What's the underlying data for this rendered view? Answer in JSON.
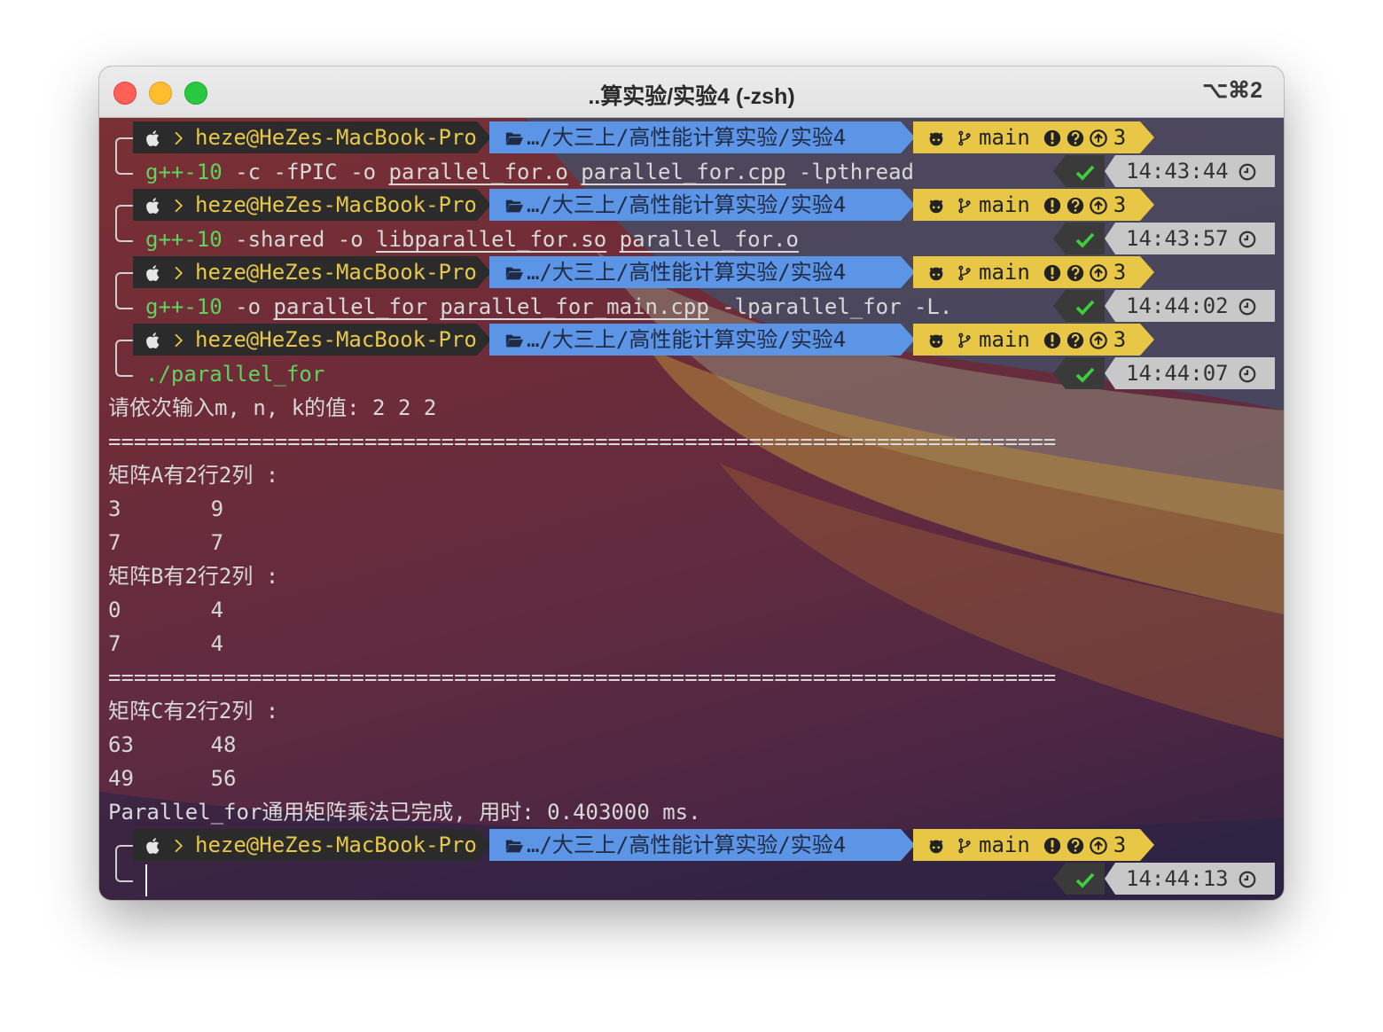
{
  "window": {
    "title": "..算实验/实验4 (-zsh)",
    "shortcut": "⌥⌘2"
  },
  "prompt": {
    "user": "heze@HeZes-MacBook-Pro",
    "dir": "…/大三上/高性能计算实验/实验4",
    "branch": "main",
    "git_count": "3"
  },
  "blocks": [
    {
      "cmd_head": "g++-10",
      "cmd_rest": " -c -fPIC -o ",
      "args": [
        "parallel_for.o",
        "parallel_for.cpp"
      ],
      "tail": " -lpthread",
      "time": "14:43:44"
    },
    {
      "cmd_head": "g++-10",
      "cmd_rest": " -shared -o ",
      "args": [
        "libparallel_for.so",
        "parallel_for.o"
      ],
      "tail": "",
      "time": "14:43:57"
    },
    {
      "cmd_head": "g++-10",
      "cmd_rest": " -o ",
      "args": [
        "parallel_for",
        "parallel_for_main.cpp"
      ],
      "tail": " -lparallel_for -L.",
      "time": "14:44:02"
    },
    {
      "cmd_head": "./parallel_for",
      "cmd_rest": "",
      "args": [],
      "tail": "",
      "time": "14:44:07"
    }
  ],
  "output": [
    "请依次输入m, n, k的值: 2 2 2",
    "==========================================================================",
    "矩阵A有2行2列 :",
    "3       9",
    "7       7",
    "矩阵B有2行2列 :",
    "0       4",
    "7       4",
    "==========================================================================",
    "矩阵C有2行2列 :",
    "63      48",
    "49      56",
    "Parallel_for通用矩阵乘法已完成, 用时: 0.403000 ms."
  ],
  "last_time": "14:44:13",
  "colors": {
    "user_bg": "#2b2b2b",
    "user_fg": "#e8c84a",
    "dir_bg": "#5c95e6",
    "git_bg": "#e7c745",
    "check": "#3ecf3e",
    "time_bg": "#c8c8c8",
    "cmd": "#5fd35f"
  },
  "icons": [
    "apple-icon",
    "chevron-right-icon",
    "folder-open-icon",
    "github-icon",
    "branch-icon",
    "exclamation-icon",
    "question-icon",
    "arrow-up-icon",
    "check-icon",
    "clock-icon"
  ]
}
